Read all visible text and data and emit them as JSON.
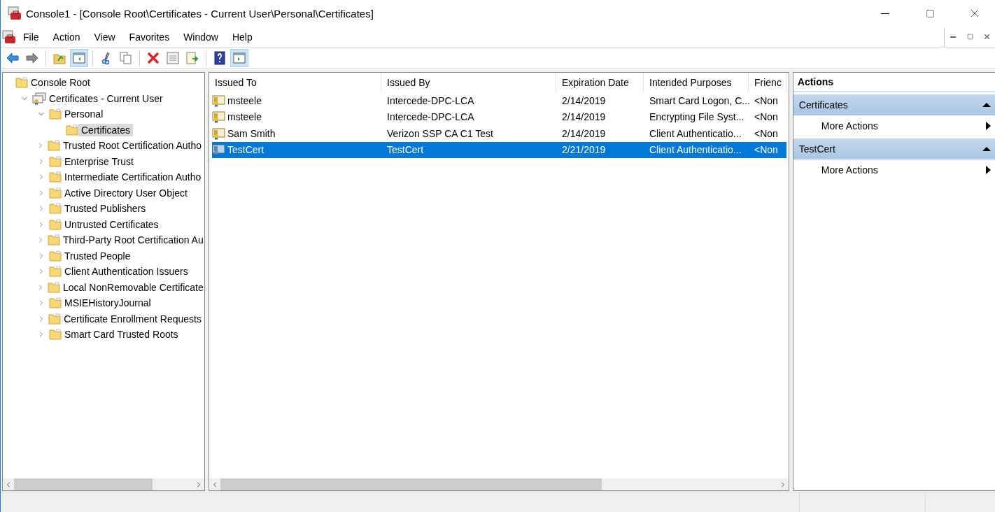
{
  "window": {
    "title": "Console1 - [Console Root\\Certificates - Current User\\Personal\\Certificates]"
  },
  "menu": [
    "File",
    "Action",
    "View",
    "Favorites",
    "Window",
    "Help"
  ],
  "toolbar": [
    {
      "kind": "back",
      "pressed": false
    },
    {
      "kind": "forward",
      "pressed": false
    },
    {
      "kind": "separator"
    },
    {
      "kind": "up",
      "pressed": false
    },
    {
      "kind": "tree",
      "pressed": true
    },
    {
      "kind": "separator"
    },
    {
      "kind": "cut",
      "pressed": false
    },
    {
      "kind": "copy",
      "pressed": false
    },
    {
      "kind": "separator"
    },
    {
      "kind": "delete",
      "pressed": false
    },
    {
      "kind": "properties",
      "pressed": false
    },
    {
      "kind": "export",
      "pressed": false
    },
    {
      "kind": "separator"
    },
    {
      "kind": "help",
      "pressed": false
    },
    {
      "kind": "actionpane",
      "pressed": true
    }
  ],
  "tree": [
    {
      "label": "Console Root",
      "kind": "folder",
      "selected": false,
      "children": [
        {
          "label": "Certificates - Current User",
          "kind": "store",
          "selected": false,
          "expanded": true,
          "children": [
            {
              "label": "Personal",
              "kind": "folder",
              "selected": false,
              "expanded": true,
              "children": [
                {
                  "label": "Certificates",
                  "kind": "folder",
                  "selected": true
                }
              ]
            },
            {
              "label": "Trusted Root Certification Autho",
              "kind": "folder",
              "selected": false,
              "expanded": false
            },
            {
              "label": "Enterprise Trust",
              "kind": "folder",
              "selected": false,
              "expanded": false
            },
            {
              "label": "Intermediate Certification Autho",
              "kind": "folder",
              "selected": false,
              "expanded": false
            },
            {
              "label": "Active Directory User Object",
              "kind": "folder",
              "selected": false,
              "expanded": false
            },
            {
              "label": "Trusted Publishers",
              "kind": "folder",
              "selected": false,
              "expanded": false
            },
            {
              "label": "Untrusted Certificates",
              "kind": "folder",
              "selected": false,
              "expanded": false
            },
            {
              "label": "Third-Party Root Certification Au",
              "kind": "folder",
              "selected": false,
              "expanded": false
            },
            {
              "label": "Trusted People",
              "kind": "folder",
              "selected": false,
              "expanded": false
            },
            {
              "label": "Client Authentication Issuers",
              "kind": "folder",
              "selected": false,
              "expanded": false
            },
            {
              "label": "Local NonRemovable Certificate",
              "kind": "folder",
              "selected": false,
              "expanded": false
            },
            {
              "label": "MSIEHistoryJournal",
              "kind": "folder",
              "selected": false,
              "expanded": false
            },
            {
              "label": "Certificate Enrollment Requests",
              "kind": "folder",
              "selected": false,
              "expanded": false
            },
            {
              "label": "Smart Card Trusted Roots",
              "kind": "folder",
              "selected": false,
              "expanded": false
            }
          ]
        }
      ]
    }
  ],
  "table": {
    "columns": [
      "Issued To",
      "Issued By",
      "Expiration Date",
      "Intended Purposes",
      "Frienc"
    ],
    "rows": [
      {
        "cells": [
          "msteele",
          "Intercede-DPC-LCA",
          "2/14/2019",
          "Smart Card Logon, C...",
          "<Non"
        ],
        "selected": false
      },
      {
        "cells": [
          "msteele",
          "Intercede-DPC-LCA",
          "2/14/2019",
          "Encrypting File Syst...",
          "<Non"
        ],
        "selected": false
      },
      {
        "cells": [
          "Sam Smith",
          "Verizon SSP CA C1 Test",
          "2/14/2019",
          "Client Authenticatio...",
          "<Non"
        ],
        "selected": false
      },
      {
        "cells": [
          "TestCert",
          "TestCert",
          "2/21/2019",
          "Client Authenticatio...",
          "<Non"
        ],
        "selected": true
      }
    ]
  },
  "actions": {
    "title": "Actions",
    "sections": [
      {
        "title": "Certificates",
        "expanded": true,
        "items": [
          "More Actions"
        ]
      },
      {
        "title": "TestCert",
        "expanded": true,
        "items": [
          "More Actions"
        ]
      }
    ]
  }
}
